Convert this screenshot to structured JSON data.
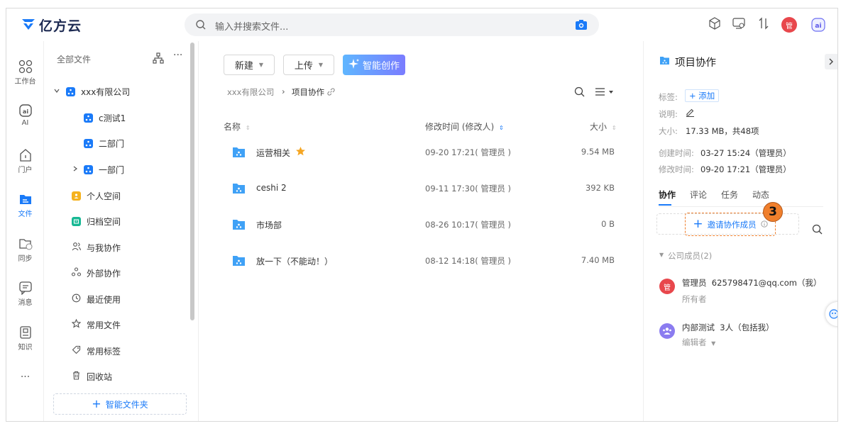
{
  "app": {
    "logo_text": "亿方云"
  },
  "search": {
    "placeholder": "输入并搜索文件..."
  },
  "top_right": {
    "avatar_text": "管"
  },
  "rail": [
    {
      "label": "工作台",
      "icon": "grid-icon"
    },
    {
      "label": "AI",
      "icon": "ai-icon"
    },
    {
      "label": "门户",
      "icon": "home-icon"
    },
    {
      "label": "文件",
      "icon": "folder-icon",
      "active": true
    },
    {
      "label": "同步",
      "icon": "sync-folder-icon"
    },
    {
      "label": "消息",
      "icon": "message-icon"
    },
    {
      "label": "知识",
      "icon": "knowledge-icon"
    }
  ],
  "rail_more": "···",
  "tree": {
    "header": "全部文件",
    "company": "xxx有限公司",
    "items": [
      {
        "label": "c测试1"
      },
      {
        "label": "二部门"
      },
      {
        "label": "一部门"
      }
    ],
    "personal": "个人空间",
    "archive": "归档空间",
    "shared_with_me": "与我协作",
    "external": "外部协作",
    "recent": "最近使用",
    "favorites": "常用文件",
    "tags": "常用标签",
    "trash": "回收站",
    "smart_folder": "智能文件夹"
  },
  "toolbar": {
    "new_label": "新建",
    "upload_label": "上传",
    "ai_label": "智能创作"
  },
  "breadcrumb": {
    "root": "xxx有限公司",
    "current": "项目协作"
  },
  "table": {
    "headers": {
      "name": "名称",
      "modified": "修改时间 (修改人)",
      "size": "大小"
    },
    "rows": [
      {
        "name": "运营相关",
        "modified": "09-20 17:21( 管理员 )",
        "size": "9.54 MB",
        "starred": true
      },
      {
        "name": "ceshi 2",
        "modified": "09-11 17:30( 管理员 )",
        "size": "392 KB"
      },
      {
        "name": "市场部",
        "modified": "08-26 10:17( 管理员 )",
        "size": "0 B"
      },
      {
        "name": "放一下（不能动！）",
        "modified": "08-12 14:18( 管理员 )",
        "size": "7.40 MB"
      }
    ]
  },
  "panel": {
    "title": "项目协作",
    "tag_label": "标签:",
    "add_tag": "+ 添加",
    "desc_label": "说明:",
    "size_label": "大小:",
    "size_value": "17.33 MB，共48项",
    "created_label": "创建时间:",
    "created_value": "03-27 15:24（管理员）",
    "modified_label": "修改时间:",
    "modified_value": "09-20 17:21（管理员）",
    "tabs": [
      "协作",
      "评论",
      "任务",
      "动态"
    ],
    "invite_label": "邀请协作成员",
    "step_badge": "3",
    "members_group": "公司成员(2)",
    "members": [
      {
        "name": "管理员  625798471@qq.com（我）",
        "role": "所有者",
        "avatar": "管",
        "color": "#e8474c"
      },
      {
        "name": "内部测试  3人（包括我）",
        "role": "编辑者",
        "avatar": "",
        "color": "#8b7cf0"
      }
    ]
  }
}
